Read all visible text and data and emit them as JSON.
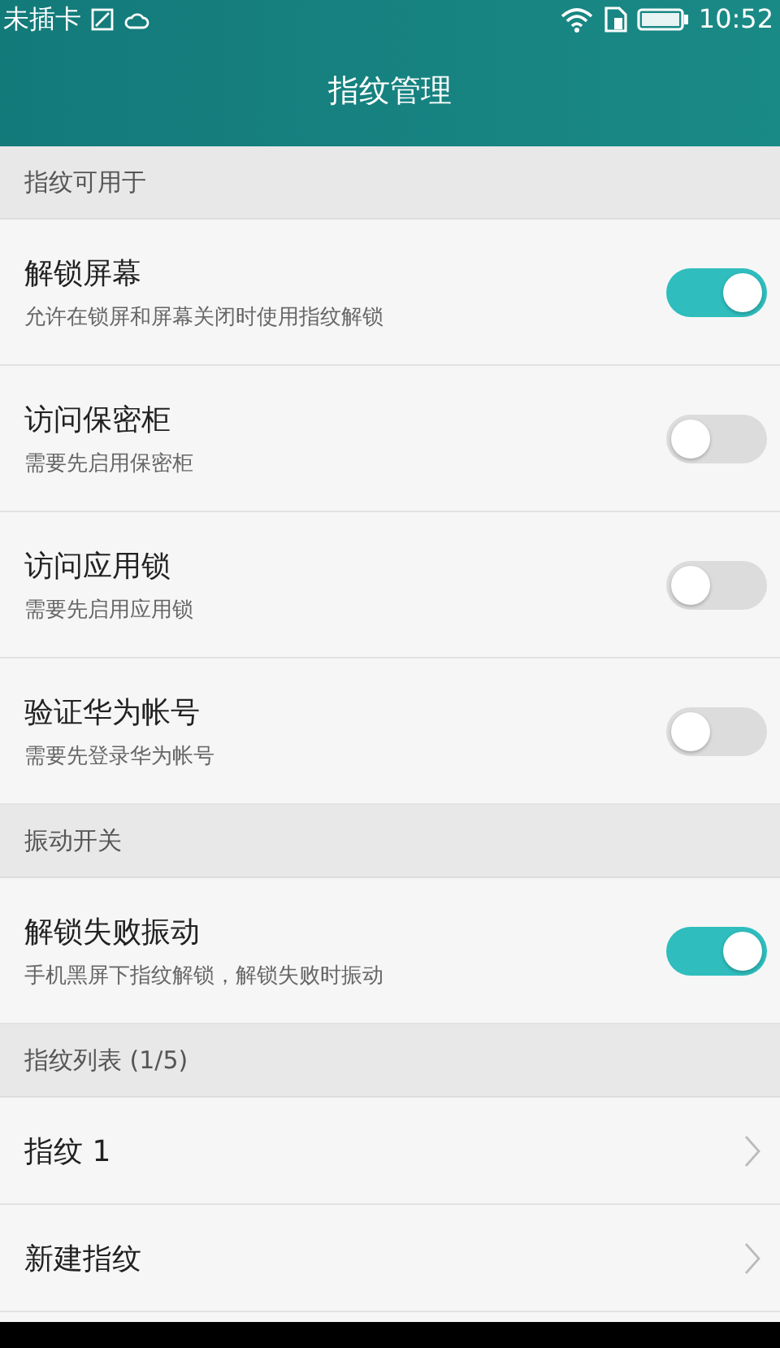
{
  "status_bar": {
    "carrier": "未插卡",
    "time": "10:52"
  },
  "title": "指纹管理",
  "sections": [
    {
      "header": "指纹可用于",
      "items": [
        {
          "kind": "toggle",
          "title": "解锁屏幕",
          "subtitle": "允许在锁屏和屏幕关闭时使用指纹解锁",
          "on": true
        },
        {
          "kind": "toggle",
          "title": "访问保密柜",
          "subtitle": "需要先启用保密柜",
          "on": false
        },
        {
          "kind": "toggle",
          "title": "访问应用锁",
          "subtitle": "需要先启用应用锁",
          "on": false
        },
        {
          "kind": "toggle",
          "title": "验证华为帐号",
          "subtitle": "需要先登录华为帐号",
          "on": false
        }
      ]
    },
    {
      "header": "振动开关",
      "items": [
        {
          "kind": "toggle",
          "title": "解锁失败振动",
          "subtitle": "手机黑屏下指纹解锁，解锁失败时振动",
          "on": true
        }
      ]
    },
    {
      "header": "指纹列表 (1/5)",
      "items": [
        {
          "kind": "link",
          "title": "指纹 1"
        },
        {
          "kind": "link",
          "title": "新建指纹"
        }
      ]
    }
  ]
}
